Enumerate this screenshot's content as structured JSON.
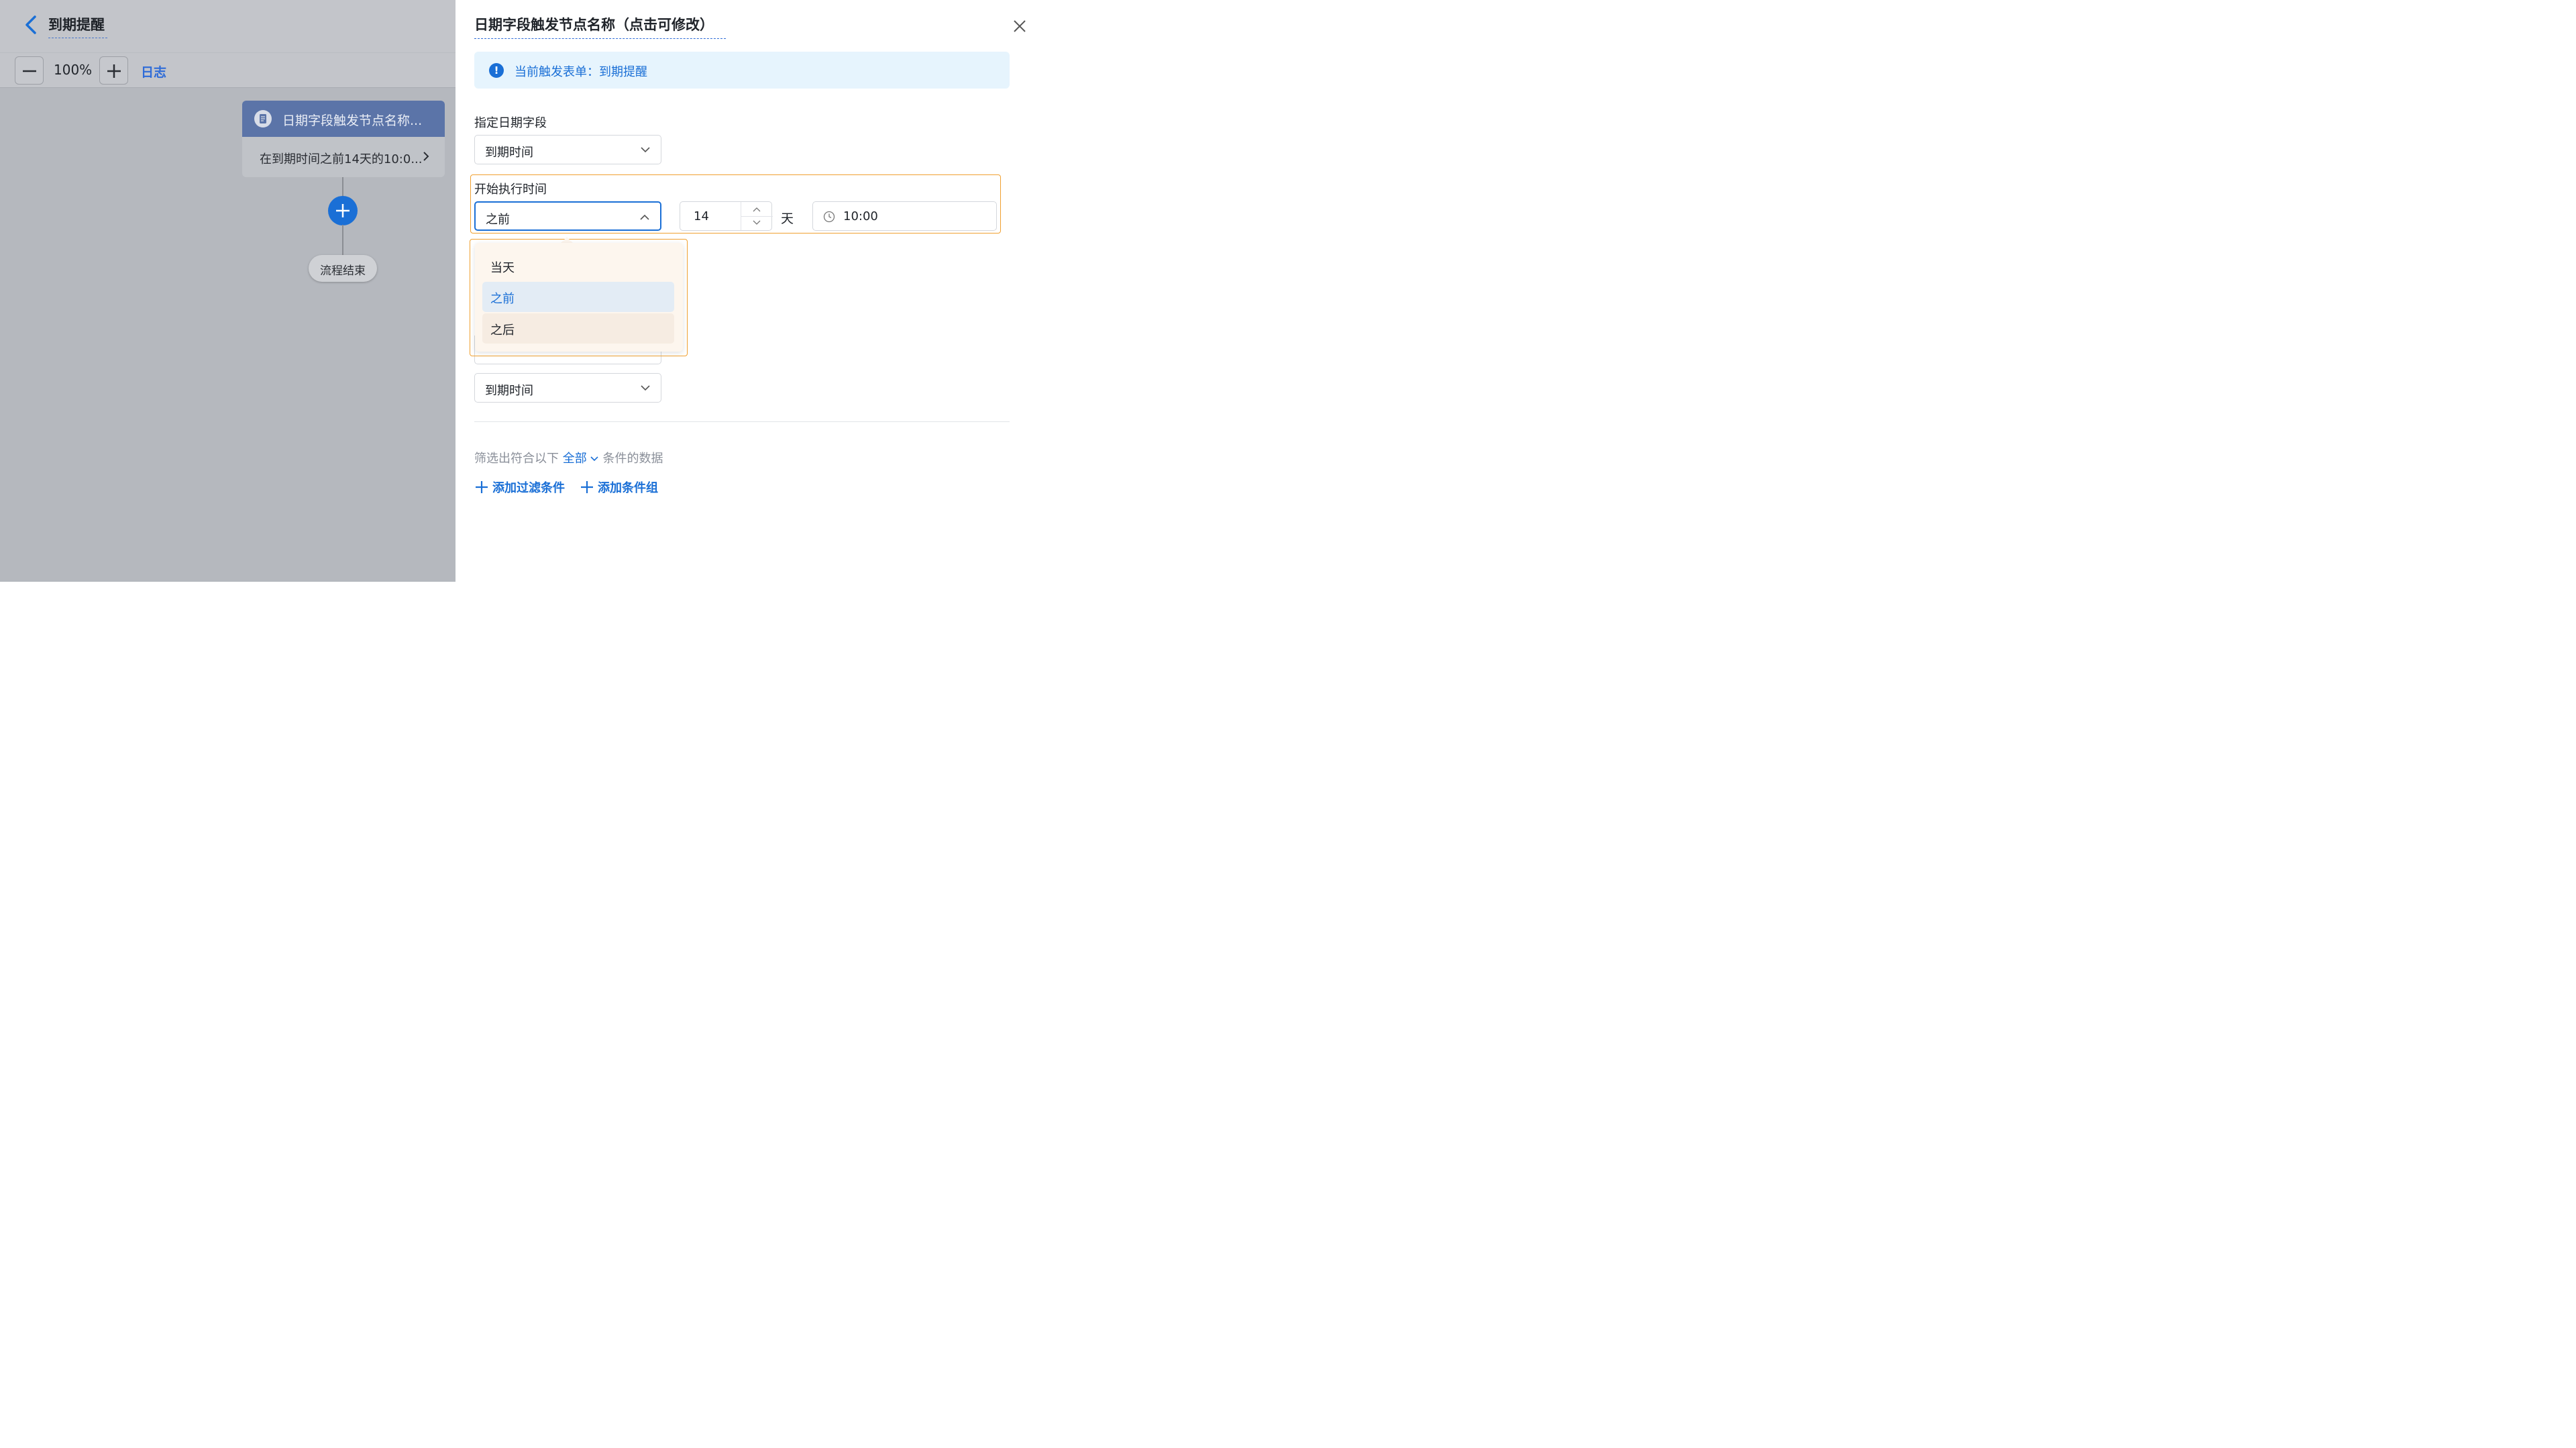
{
  "header": {
    "title": "到期提醒"
  },
  "toolbar": {
    "zoom": "100%",
    "log_label": "日志"
  },
  "flow": {
    "trigger_node": {
      "title": "日期字段触发节点名称...",
      "description": "在到期时间之前14天的10:0..."
    },
    "end_node": {
      "label": "流程结束"
    }
  },
  "panel": {
    "title": "日期字段触发节点名称（点击可修改）",
    "info": {
      "text": "当前触发表单：到期提醒"
    },
    "date_field": {
      "label": "指定日期字段",
      "value": "到期时间"
    },
    "start_time": {
      "label": "开始执行时间",
      "relation": "之前",
      "days": "14",
      "day_unit": "天",
      "time": "10:00"
    },
    "relation_options": [
      {
        "label": "当天",
        "selected": false
      },
      {
        "label": "之前",
        "selected": true
      },
      {
        "label": "之后",
        "selected": false,
        "hovered": true
      }
    ],
    "second_field": {
      "value": "到期时间"
    },
    "filter": {
      "prefix": "筛选出符合以下",
      "scope": "全部",
      "suffix": "条件的数据"
    },
    "add_filter_label": "添加过滤条件",
    "add_group_label": "添加条件组"
  },
  "colors": {
    "accent": "#1a6fd6",
    "highlight": "#f0a030",
    "overlay": "#b5b8be"
  }
}
